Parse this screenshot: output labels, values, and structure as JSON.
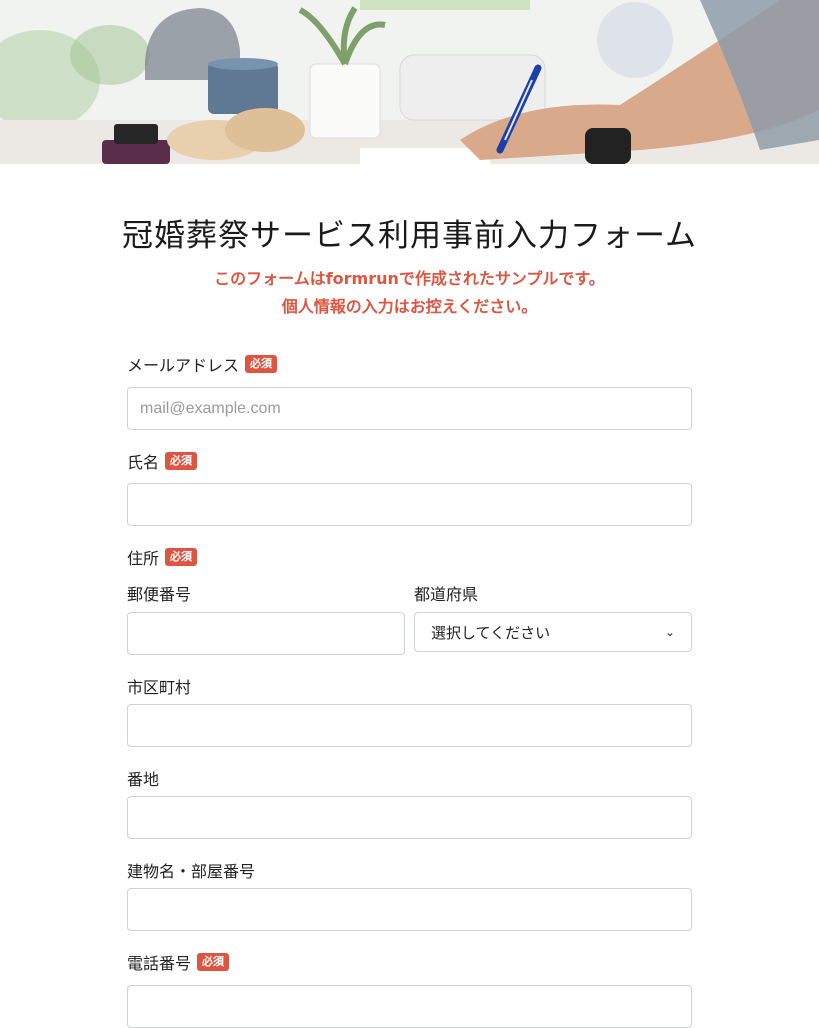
{
  "hero": {
    "description_icon": "desk-photo"
  },
  "form": {
    "title": "冠婚葬祭サービス利用事前入力フォーム",
    "notice_line1": "このフォームはformrunで作成されたサンプルです。",
    "notice_line2": "個人情報の入力はお控えください。",
    "required_badge": "必須",
    "email": {
      "label": "メールアドレス",
      "placeholder": "mail@example.com",
      "value": ""
    },
    "name": {
      "label": "氏名",
      "value": ""
    },
    "address": {
      "label": "住所",
      "postal_label": "郵便番号",
      "prefecture_label": "都道府県",
      "prefecture_selected": "選択してください",
      "city_label": "市区町村",
      "street_label": "番地",
      "building_label": "建物名・部屋番号"
    },
    "phone": {
      "label": "電話番号",
      "value": ""
    }
  }
}
